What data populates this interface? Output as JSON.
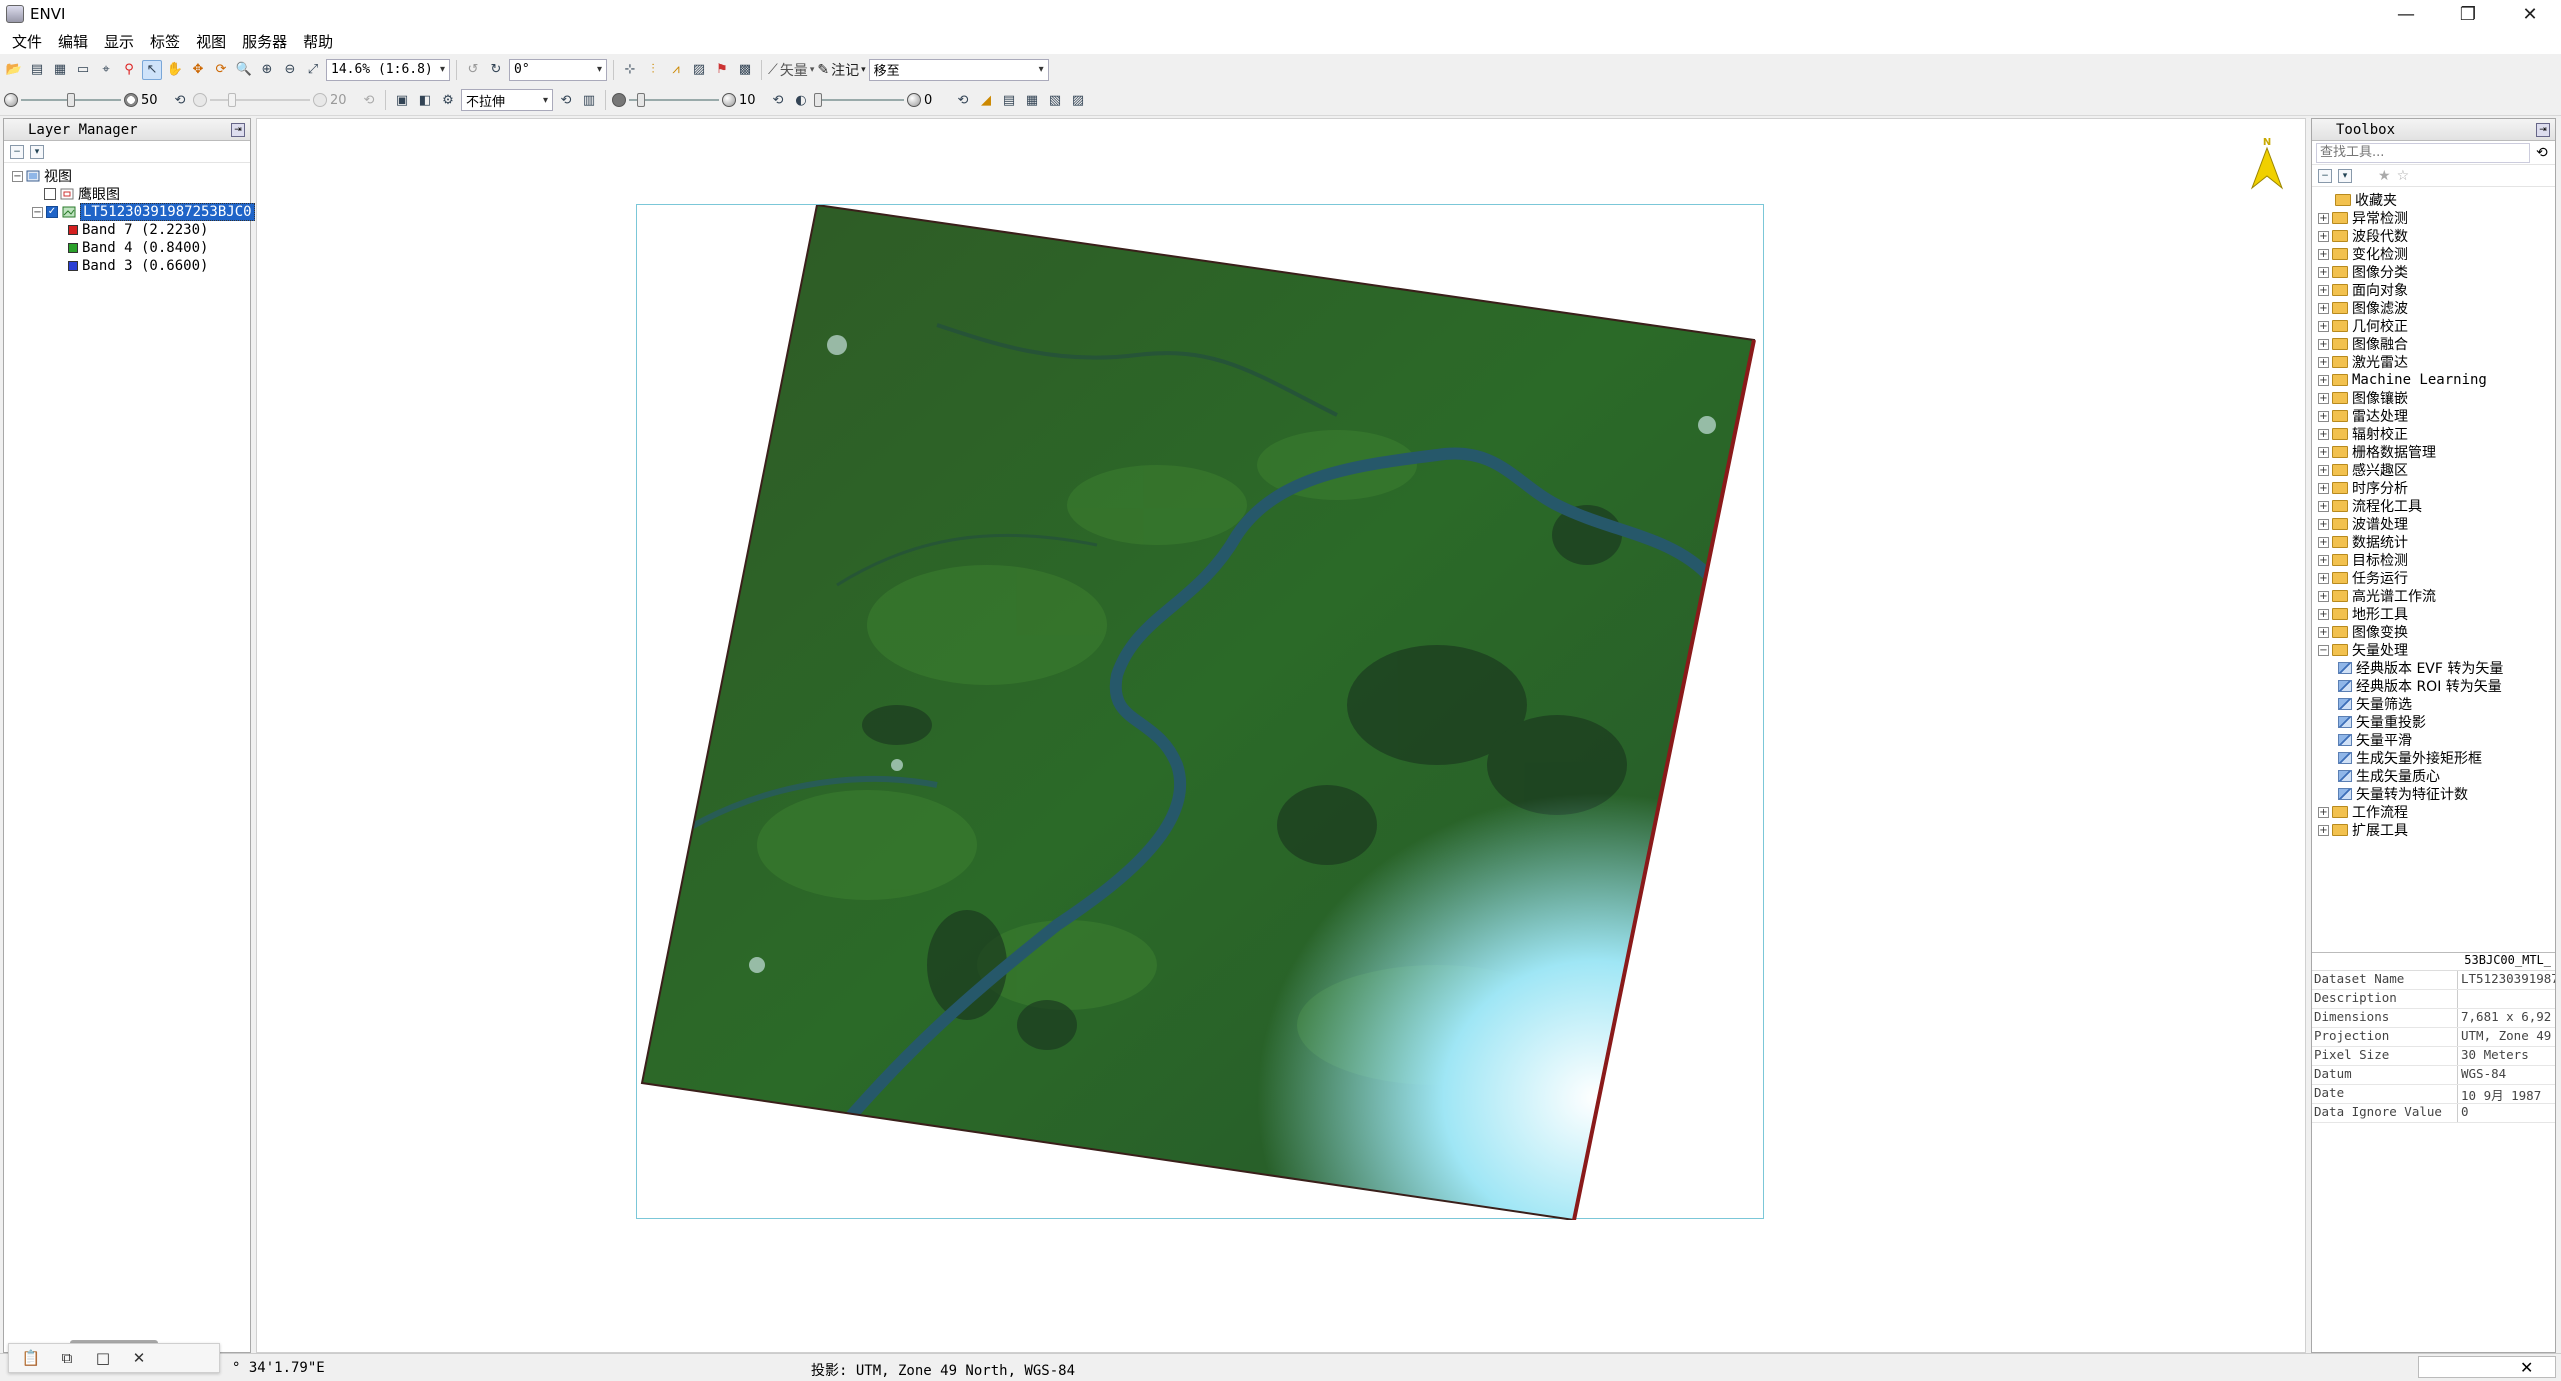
{
  "window": {
    "title": "ENVI",
    "controls": {
      "minimize": "—",
      "restore": "❐",
      "close": "✕"
    }
  },
  "menu": [
    "文件",
    "编辑",
    "显示",
    "标签",
    "视图",
    "服务器",
    "帮助"
  ],
  "toolbar1": {
    "zoom": "14.6% (1:6.8)",
    "rotation": "0°",
    "vector_label": "矢量",
    "annotation_label": "注记",
    "goto": "移至"
  },
  "toolbar2": {
    "brightness": {
      "value": "50",
      "level": 0.5
    },
    "contrast": {
      "value": "20",
      "level": 0.2
    },
    "stretch": "不拉伸",
    "sharpen": {
      "value": "10",
      "level": 0.1
    },
    "transparency": {
      "value": "0",
      "level": 0.0
    }
  },
  "layer_manager": {
    "title": "Layer Manager",
    "tree": {
      "root": "视图",
      "overview": "鹰眼图",
      "layer": "LT51230391987253BJC0",
      "bands": [
        {
          "label": "Band 7 (2.2230)",
          "color": "#d42020"
        },
        {
          "label": "Band 4 (0.8400)",
          "color": "#2aa02a"
        },
        {
          "label": "Band 3 (0.6600)",
          "color": "#2a3fd4"
        }
      ]
    }
  },
  "view": {
    "north_label": "N"
  },
  "toolbox": {
    "title": "Toolbox",
    "search_placeholder": "查找工具...",
    "folders": [
      "收藏夹",
      "异常检测",
      "波段代数",
      "变化检测",
      "图像分类",
      "面向对象",
      "图像滤波",
      "几何校正",
      "图像融合",
      "激光雷达",
      "Machine Learning",
      "图像镶嵌",
      "雷达处理",
      "辐射校正",
      "栅格数据管理",
      "感兴趣区",
      "时序分析",
      "流程化工具",
      "波谱处理",
      "数据统计",
      "目标检测",
      "任务运行",
      "高光谱工作流",
      "地形工具",
      "图像变换"
    ],
    "expanded_folder": "矢量处理",
    "vector_tools": [
      "经典版本 EVF 转为矢量",
      "经典版本 ROI 转为矢量",
      "矢量筛选",
      "矢量重投影",
      "矢量平滑",
      "生成矢量外接矩形框",
      "生成矢量质心",
      "矢量转为特征计数"
    ],
    "trailing_folders": [
      "工作流程",
      "扩展工具"
    ]
  },
  "properties": {
    "title": "53BJC00_MTL_",
    "rows": [
      {
        "key": "Dataset Name",
        "value": "LT51230391987"
      },
      {
        "key": "Description",
        "value": ""
      },
      {
        "key": "Dimensions",
        "value": "7,681 x 6,92"
      },
      {
        "key": "Projection",
        "value": "UTM, Zone 49"
      },
      {
        "key": "Pixel Size",
        "value": "30 Meters"
      },
      {
        "key": "Datum",
        "value": "WGS-84"
      },
      {
        "key": "Date",
        "value": "10 9月 1987"
      },
      {
        "key": "Data Ignore Value",
        "value": "0"
      }
    ]
  },
  "statusbar": {
    "coord": "° 34'1.79\"E",
    "projection": "投影: UTM, Zone 49 North, WGS-84"
  },
  "colors": {
    "selection": "#1f64c8",
    "frame": "#7bc7d8",
    "north_arrow": "#f0d000"
  }
}
